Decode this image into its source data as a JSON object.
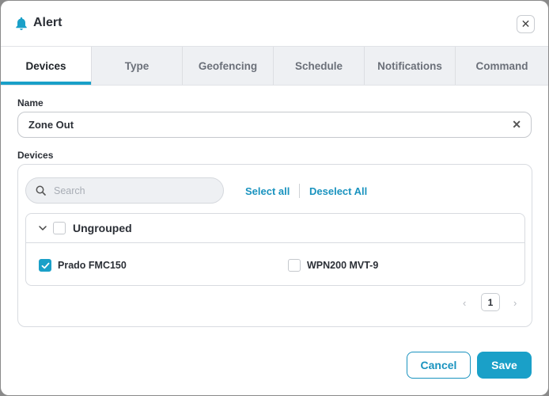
{
  "dialog": {
    "title": "Alert",
    "close_symbol": "✕",
    "icon": "bell-icon"
  },
  "tabs": [
    {
      "label": "Devices",
      "active": true
    },
    {
      "label": "Type",
      "active": false
    },
    {
      "label": "Geofencing",
      "active": false
    },
    {
      "label": "Schedule",
      "active": false
    },
    {
      "label": "Notifications",
      "active": false
    },
    {
      "label": "Command",
      "active": false
    }
  ],
  "form": {
    "name_label": "Name",
    "name_value": "Zone Out",
    "clear_symbol": "✕",
    "devices_label": "Devices"
  },
  "devices": {
    "search_placeholder": "Search",
    "select_all": "Select all",
    "deselect_all": "Deselect All",
    "group": {
      "title": "Ungrouped",
      "checked": false,
      "expanded": true,
      "items": [
        {
          "label": "Prado FMC150",
          "checked": true
        },
        {
          "label": "WPN200 MVT-9",
          "checked": false
        }
      ]
    },
    "pagination": {
      "prev": "‹",
      "current": "1",
      "next": "›"
    }
  },
  "footer": {
    "cancel_label": "Cancel",
    "save_label": "Save"
  },
  "colors": {
    "accent": "#1aa0c8",
    "link": "#1a93bf",
    "tab_background": "#eef0f3"
  }
}
